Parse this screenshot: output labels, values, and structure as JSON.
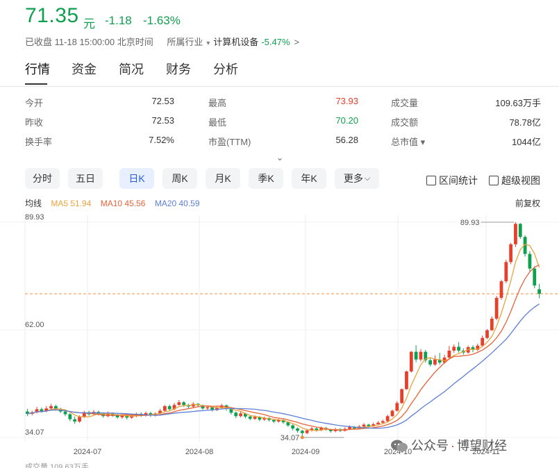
{
  "quote": {
    "price": "71.35",
    "unit": "元",
    "change": "-1.18",
    "change_pct": "-1.63%"
  },
  "status": {
    "text": "已收盘 11-18 15:00:00 北京时间",
    "industry_label": "所属行业",
    "industry_name": "计算机设备",
    "industry_pct": "-5.47%",
    "chevron": ">"
  },
  "tabs": [
    "行情",
    "资金",
    "简况",
    "财务",
    "分析"
  ],
  "stats": [
    {
      "label": "今开",
      "value": "72.53",
      "color": ""
    },
    {
      "label": "最高",
      "value": "73.93",
      "color": "red"
    },
    {
      "label": "成交量",
      "value": "109.63万手",
      "color": ""
    },
    {
      "label": "昨收",
      "value": "72.53",
      "color": ""
    },
    {
      "label": "最低",
      "value": "70.20",
      "color": "green"
    },
    {
      "label": "成交额",
      "value": "78.78亿",
      "color": ""
    },
    {
      "label": "换手率",
      "value": "7.52%",
      "color": ""
    },
    {
      "label": "市盈(TTM)",
      "value": "56.28",
      "color": ""
    },
    {
      "label": "总市值 ▾",
      "value": "1044亿",
      "color": ""
    }
  ],
  "expand_glyph": "⌄",
  "period_buttons": [
    "分时",
    "五日",
    "日K",
    "周K",
    "月K",
    "季K",
    "年K",
    "更多"
  ],
  "more_chevron": "⌵",
  "active_period": "日K",
  "tools": {
    "range_stats": "区间统计",
    "super_view": "超级视图"
  },
  "ma": {
    "title": "均线",
    "ma5": "MA5 51.94",
    "ma10": "MA10 45.56",
    "ma20": "MA20 40.59",
    "colors": {
      "ma5": "#e8a33d",
      "ma10": "#e4633a",
      "ma20": "#5b7fd6",
      "up": "#e6402b",
      "down": "#0e9f4f"
    }
  },
  "adjust_label": "前复权",
  "watermark": {
    "prefix": "公众号",
    "dot": "·",
    "name": "博望财经"
  },
  "bottom_text": "成交量 109.63万手",
  "chart_data": {
    "type": "candlestick",
    "y_tick_labels": [
      "89.93",
      "62.00",
      "34.07"
    ],
    "x_tick_labels": [
      "2024-07",
      "2024-08",
      "2024-09",
      "2024-10",
      "2024-11"
    ],
    "ylim": [
      34.07,
      89.93
    ],
    "high_marker": "89.93",
    "low_marker": "34.07",
    "current_price": 71.35,
    "candles": [
      [
        40.8,
        40.2,
        41.5,
        39.6
      ],
      [
        40.2,
        40.6,
        41.0,
        39.8
      ],
      [
        40.6,
        41.4,
        42.0,
        40.3
      ],
      [
        41.4,
        40.9,
        41.8,
        40.5
      ],
      [
        40.9,
        41.6,
        42.2,
        40.6
      ],
      [
        41.6,
        42.2,
        42.8,
        41.2
      ],
      [
        42.2,
        41.5,
        42.6,
        41.0
      ],
      [
        41.5,
        40.8,
        41.8,
        40.4
      ],
      [
        40.8,
        40.1,
        41.2,
        39.6
      ],
      [
        40.1,
        38.8,
        40.4,
        38.3
      ],
      [
        38.8,
        38.2,
        39.5,
        37.6
      ],
      [
        38.2,
        39.4,
        39.8,
        37.9
      ],
      [
        39.4,
        40.6,
        41.0,
        39.1
      ],
      [
        40.6,
        40.1,
        41.0,
        39.7
      ],
      [
        40.1,
        40.7,
        41.2,
        39.8
      ],
      [
        40.7,
        40.2,
        41.0,
        39.8
      ],
      [
        40.2,
        39.6,
        40.5,
        39.2
      ],
      [
        39.6,
        40.3,
        40.8,
        39.3
      ],
      [
        40.3,
        39.9,
        40.6,
        39.4
      ],
      [
        39.9,
        39.3,
        40.2,
        38.9
      ],
      [
        39.3,
        39.8,
        40.1,
        38.9
      ],
      [
        39.8,
        39.2,
        40.0,
        38.7
      ],
      [
        39.2,
        39.7,
        40.1,
        38.9
      ],
      [
        39.7,
        40.2,
        40.5,
        39.3
      ],
      [
        40.2,
        39.8,
        40.6,
        39.4
      ],
      [
        39.8,
        40.4,
        40.8,
        39.5
      ],
      [
        40.4,
        39.9,
        40.7,
        39.4
      ],
      [
        39.9,
        40.3,
        40.6,
        39.5
      ],
      [
        40.3,
        41.0,
        41.5,
        40.1
      ],
      [
        41.0,
        42.2,
        42.5,
        40.8
      ],
      [
        42.2,
        41.4,
        42.6,
        41.0
      ],
      [
        41.4,
        42.5,
        43.0,
        41.1
      ],
      [
        42.5,
        43.2,
        43.8,
        42.3
      ],
      [
        43.2,
        42.5,
        43.5,
        42.0
      ],
      [
        42.5,
        42.1,
        42.8,
        41.6
      ],
      [
        42.1,
        42.8,
        43.2,
        41.8
      ],
      [
        42.8,
        42.4,
        43.0,
        42.0
      ],
      [
        42.4,
        41.6,
        42.6,
        41.2
      ],
      [
        41.6,
        41.9,
        42.3,
        41.2
      ],
      [
        41.9,
        41.2,
        42.1,
        40.8
      ],
      [
        41.2,
        41.8,
        42.2,
        40.9
      ],
      [
        41.8,
        42.4,
        42.8,
        41.5
      ],
      [
        42.4,
        41.5,
        42.6,
        41.0
      ],
      [
        41.5,
        40.5,
        41.7,
        40.0
      ],
      [
        40.5,
        39.6,
        40.8,
        39.1
      ],
      [
        39.6,
        40.3,
        40.8,
        39.3
      ],
      [
        40.3,
        39.5,
        40.5,
        39.0
      ],
      [
        39.5,
        38.9,
        39.8,
        38.5
      ],
      [
        38.9,
        39.4,
        39.8,
        38.6
      ],
      [
        39.4,
        38.7,
        39.6,
        38.3
      ],
      [
        38.7,
        39.1,
        39.5,
        38.4
      ],
      [
        39.1,
        38.6,
        39.3,
        38.2
      ],
      [
        38.6,
        38.2,
        38.8,
        37.8
      ],
      [
        38.2,
        38.6,
        38.9,
        37.9
      ],
      [
        38.6,
        38.0,
        38.8,
        37.6
      ],
      [
        38.0,
        37.2,
        38.2,
        36.8
      ],
      [
        37.2,
        36.4,
        37.5,
        35.9
      ],
      [
        36.4,
        35.8,
        36.7,
        35.3
      ],
      [
        35.8,
        35.2,
        36.1,
        34.07
      ],
      [
        35.2,
        35.9,
        36.3,
        34.9
      ],
      [
        35.9,
        36.4,
        36.8,
        35.6
      ],
      [
        36.4,
        36.0,
        36.7,
        35.6
      ],
      [
        36.0,
        36.5,
        36.9,
        35.7
      ],
      [
        36.5,
        36.1,
        36.8,
        35.8
      ],
      [
        36.1,
        35.7,
        36.3,
        35.3
      ],
      [
        35.7,
        36.2,
        36.6,
        35.4
      ],
      [
        36.2,
        35.8,
        36.5,
        35.5
      ],
      [
        35.8,
        36.3,
        36.7,
        35.6
      ],
      [
        36.3,
        36.8,
        37.2,
        36.0
      ],
      [
        36.8,
        36.4,
        37.0,
        36.1
      ],
      [
        36.4,
        36.9,
        37.3,
        36.2
      ],
      [
        36.9,
        37.4,
        37.8,
        36.7
      ],
      [
        37.4,
        37.0,
        37.6,
        36.7
      ],
      [
        37.0,
        37.5,
        37.9,
        36.8
      ],
      [
        37.5,
        37.9,
        38.3,
        37.2
      ],
      [
        37.9,
        38.3,
        38.7,
        37.6
      ],
      [
        38.3,
        39.6,
        40.0,
        38.1
      ],
      [
        39.6,
        41.0,
        41.3,
        39.4
      ],
      [
        41.0,
        43.0,
        43.5,
        40.8
      ],
      [
        43.0,
        46.6,
        46.8,
        42.8
      ],
      [
        46.6,
        51.2,
        51.4,
        46.4
      ],
      [
        51.2,
        56.3,
        56.5,
        50.9
      ],
      [
        56.3,
        54.3,
        58.0,
        53.6
      ],
      [
        54.3,
        56.3,
        57.0,
        53.8
      ],
      [
        56.3,
        54.1,
        56.8,
        53.5
      ],
      [
        54.1,
        53.0,
        54.8,
        52.5
      ],
      [
        53.0,
        54.3,
        55.4,
        52.6
      ],
      [
        54.3,
        53.5,
        56.0,
        53.0
      ],
      [
        53.5,
        54.8,
        55.5,
        53.2
      ],
      [
        54.8,
        56.6,
        57.8,
        54.5
      ],
      [
        56.6,
        57.6,
        58.2,
        56.0
      ],
      [
        57.6,
        56.6,
        58.8,
        56.1
      ],
      [
        56.6,
        56.1,
        57.2,
        55.6
      ],
      [
        56.1,
        57.5,
        57.9,
        55.8
      ],
      [
        57.5,
        56.8,
        58.0,
        56.2
      ],
      [
        56.8,
        57.9,
        58.4,
        56.5
      ],
      [
        57.9,
        59.9,
        60.5,
        57.7
      ],
      [
        59.9,
        61.9,
        62.2,
        59.6
      ],
      [
        61.9,
        64.9,
        65.5,
        61.7
      ],
      [
        64.9,
        70.3,
        70.8,
        64.5
      ],
      [
        70.3,
        74.6,
        75.0,
        69.8
      ],
      [
        74.6,
        79.6,
        80.2,
        74.1
      ],
      [
        79.6,
        84.2,
        84.6,
        79.0
      ],
      [
        84.2,
        89.5,
        89.93,
        83.5
      ],
      [
        89.5,
        86.1,
        89.7,
        85.6
      ],
      [
        86.1,
        81.7,
        86.5,
        81.0
      ],
      [
        81.7,
        77.9,
        82.4,
        77.2
      ],
      [
        77.9,
        73.5,
        78.5,
        72.8
      ],
      [
        72.53,
        71.35,
        73.93,
        70.2
      ]
    ]
  }
}
